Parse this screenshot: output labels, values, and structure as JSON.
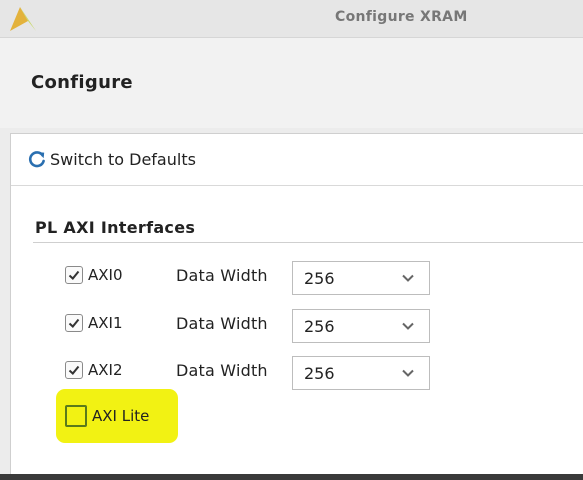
{
  "window": {
    "title": "Configure XRAM"
  },
  "header": {
    "title": "Configure"
  },
  "toolbar": {
    "switch_defaults_label": "Switch to Defaults",
    "icon": "refresh-icon"
  },
  "section": {
    "title": "PL AXI Interfaces"
  },
  "interfaces": [
    {
      "label": "AXI0",
      "checked": true,
      "data_width_label": "Data Width",
      "data_width_value": "256"
    },
    {
      "label": "AXI1",
      "checked": true,
      "data_width_label": "Data Width",
      "data_width_value": "256"
    },
    {
      "label": "AXI2",
      "checked": true,
      "data_width_label": "Data Width",
      "data_width_value": "256"
    }
  ],
  "axi_lite": {
    "label": "AXI Lite",
    "checked": false,
    "highlighted": true
  },
  "colors": {
    "accent": "#2a6fb0",
    "highlight": "#f2f213",
    "check": "#333333"
  }
}
